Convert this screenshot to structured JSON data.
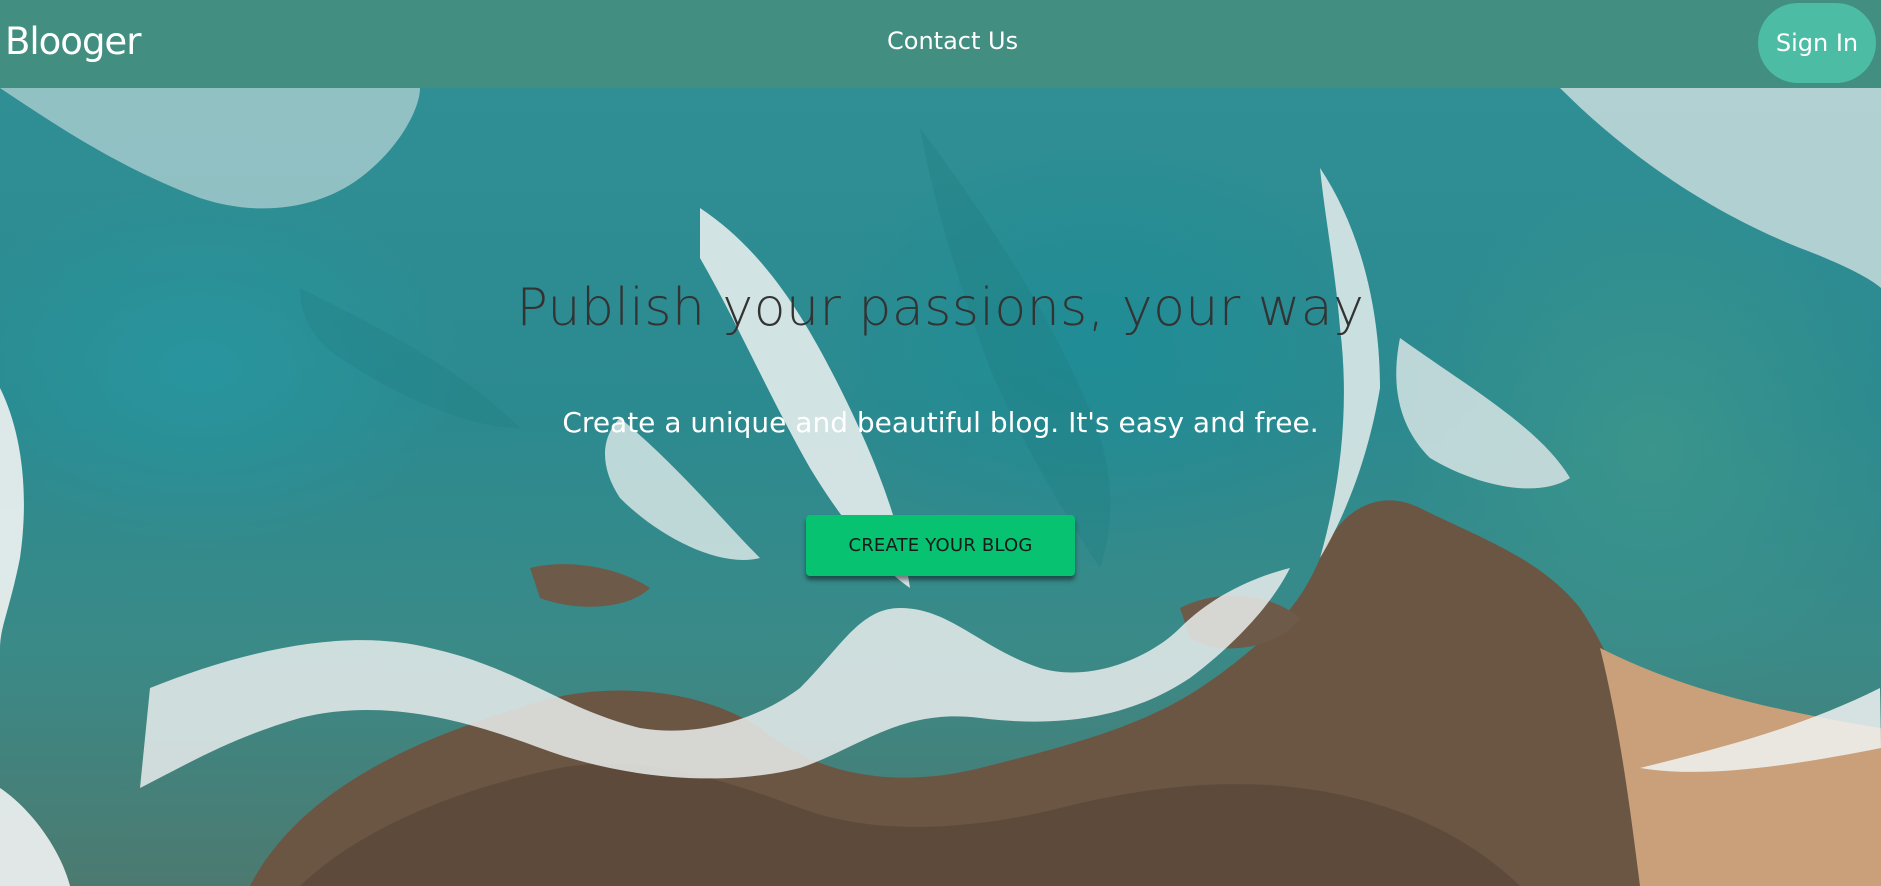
{
  "header": {
    "brand": "Blooger",
    "contact_label": "Contact Us",
    "signin_label": "Sign In"
  },
  "hero": {
    "headline": "Publish your passions, your way",
    "subheadline": "Create a unique and beautiful blog. It's easy and free.",
    "cta_label": "CREATE YOUR BLOG",
    "background": "aerial-ocean-waves-rocks-image"
  },
  "colors": {
    "navbar": "#428e80",
    "signin_button": "#4dbca4",
    "cta_button": "#06c271",
    "headline_text": "#333333",
    "subheadline_text": "#ffffff"
  }
}
